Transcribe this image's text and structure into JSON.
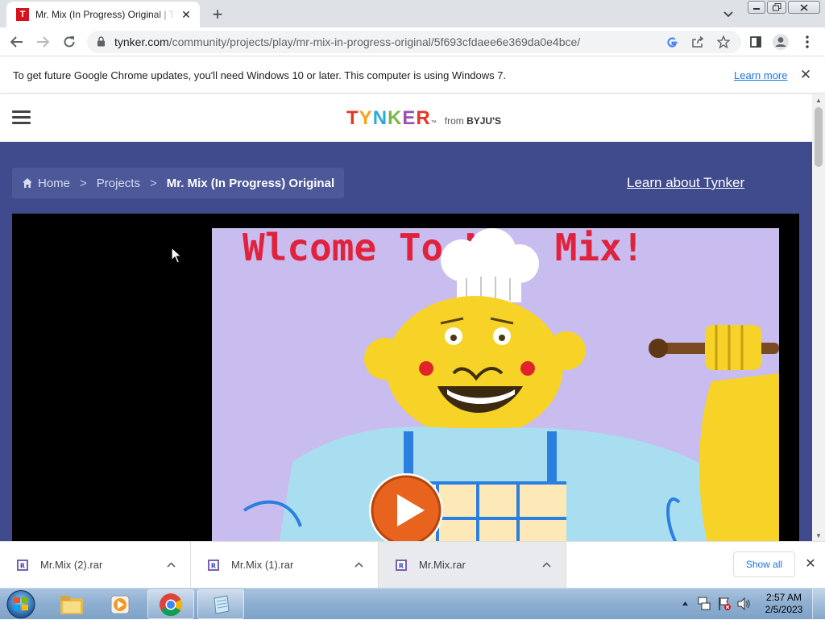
{
  "browser": {
    "tab_title": "Mr. Mix (In Progress) Original | Tynker",
    "tab_favicon_letter": "T",
    "url_host": "tynker.com",
    "url_path": "/community/projects/play/mr-mix-in-progress-original/5f693cfdaee6e369da0e4bce/"
  },
  "infobar": {
    "message": "To get future Google Chrome updates, you'll need Windows 10 or later. This computer is using Windows 7.",
    "learn_more": "Learn more"
  },
  "site": {
    "logo_letters": [
      "T",
      "Y",
      "N",
      "K",
      "E",
      "R"
    ],
    "logo_colors": [
      "#e4372a",
      "#f7a21b",
      "#2aa9e0",
      "#7ab648",
      "#9b4fb5",
      "#e4372a"
    ],
    "from_prefix": "from ",
    "from_brand": "BYJU'S",
    "breadcrumb": {
      "home": "Home",
      "sep": ">",
      "projects": "Projects",
      "current": "Mr. Mix (In Progress) Original"
    },
    "learn_link": "Learn about Tynker"
  },
  "project": {
    "stage_text": "Wlcome To Mr. Mix!"
  },
  "downloads": {
    "items": [
      {
        "name": "Mr.Mix (2).rar"
      },
      {
        "name": "Mr.Mix (1).rar"
      },
      {
        "name": "Mr.Mix.rar"
      }
    ],
    "show_all": "Show all"
  },
  "taskbar": {
    "time": "2:57 AM",
    "date": "2/5/2023"
  },
  "colors": {
    "banner": "#3f4b8c",
    "play_button": "#e8641e",
    "stage_bg": "#c9bcee"
  }
}
